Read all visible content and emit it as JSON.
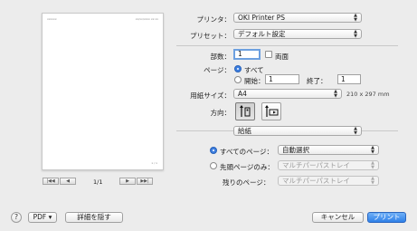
{
  "preview": {
    "header_left": "xxxxxx",
    "header_right": "xx/xx/xxxx xx:xx",
    "footer_right": "x / x",
    "nav_first": "|◀◀",
    "nav_prev": "◀",
    "nav_next": "▶",
    "nav_last": "▶▶|",
    "page_indicator": "1/1"
  },
  "printer": {
    "label": "プリンタ：",
    "value": "OKI Printer PS"
  },
  "preset": {
    "label": "プリセット：",
    "value": "デフォルト設定"
  },
  "copies": {
    "label": "部数：",
    "value": "1",
    "duplex_label": "両面"
  },
  "pages": {
    "label": "ページ：",
    "all_label": "すべて",
    "from_label": "開始：",
    "from_value": "1",
    "to_label": "終了：",
    "to_value": "1"
  },
  "paper_size": {
    "label": "用紙サイズ：",
    "value": "A4",
    "dimensions": "210 x 297 mm"
  },
  "orientation": {
    "label": "方向：",
    "portrait_icon": "portrait-icon",
    "landscape_icon": "landscape-icon"
  },
  "section": {
    "value": "給紙"
  },
  "feed": {
    "all_pages_label": "すべてのページ：",
    "all_pages_value": "自動選択",
    "first_page_label": "先頭ページのみ：",
    "first_page_value": "マルチパーパストレイ",
    "remaining_label": "残りのページ：",
    "remaining_value": "マルチパーパストレイ"
  },
  "footer": {
    "help": "?",
    "pdf": "PDF ▾",
    "hide_details": "詳細を隠す",
    "cancel": "キャンセル",
    "print": "プリント"
  },
  "colors": {
    "accent": "#2f80e8",
    "background": "#ececec"
  }
}
